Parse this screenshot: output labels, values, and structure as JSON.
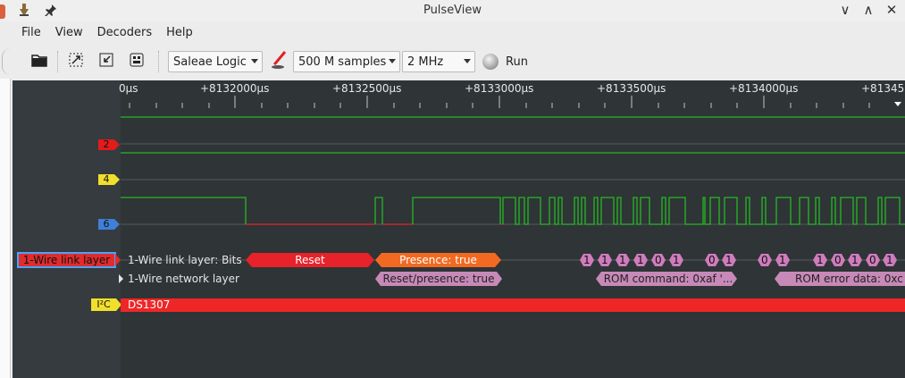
{
  "window": {
    "title": "PulseView",
    "controls": [
      "∨",
      "∧",
      "✕"
    ]
  },
  "menu": {
    "items": [
      "File",
      "View",
      "Decoders",
      "Help"
    ]
  },
  "toolbar": {
    "device": "Saleae Logic",
    "samples": "500 M samples",
    "samplerate": "2 MHz",
    "run_label": "Run"
  },
  "ruler": {
    "labels": [
      "0µs",
      "+8132000µs",
      "+8132500µs",
      "+8133000µs",
      "+8133500µs",
      "+8134000µs",
      "+81345"
    ]
  },
  "channels": {
    "ch2": "2",
    "ch4": "4",
    "ch6": "6"
  },
  "decoders": {
    "onewire_tag": "1-Wire link layer",
    "bits_label": "1-Wire link layer: Bits",
    "network_label": "1-Wire network layer",
    "reset": "Reset",
    "presence": "Presence: true",
    "reset_presence": "Reset/presence: true",
    "rom_command": "ROM command: 0xaf '...",
    "rom_error": "ROM error data: 0xc",
    "bits": [
      "1",
      "1",
      "1",
      "1",
      "0",
      "1",
      "0",
      "1",
      "0",
      "1",
      "1",
      "0",
      "1",
      "0",
      "1"
    ],
    "i2c_tag": "I²C",
    "i2c_label": "DS1307"
  },
  "colors": {
    "trace_green": "#25b825",
    "trace_red": "#e0242a",
    "reset_red": "#e8222a",
    "presence_orange": "#f26a21",
    "network_purple": "#c789b8",
    "bit_purple": "#cf7cbd",
    "bg_dark": "#2f3436"
  }
}
